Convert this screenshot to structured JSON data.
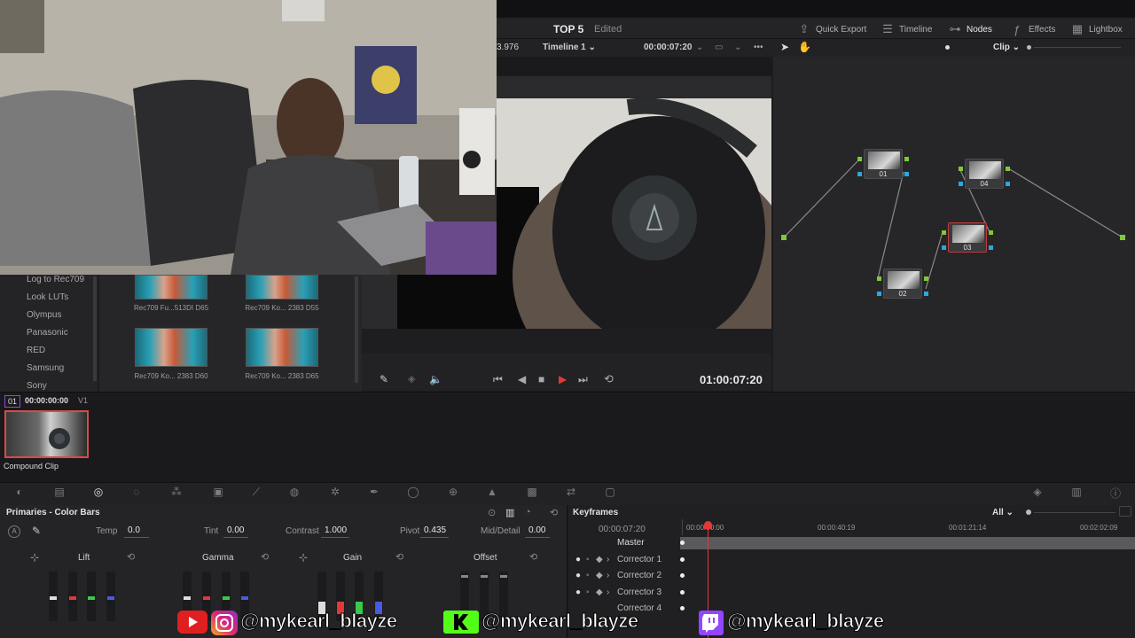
{
  "header": {
    "project_title": "TOP 5",
    "project_status": "Edited",
    "toolbar": [
      {
        "icon": "export-icon",
        "label": "Quick Export"
      },
      {
        "icon": "timeline-icon",
        "label": "Timeline"
      },
      {
        "icon": "nodes-icon",
        "label": "Nodes"
      },
      {
        "icon": "effects-icon",
        "label": "Effects"
      },
      {
        "icon": "lightbox-icon",
        "label": "Lightbox"
      }
    ]
  },
  "viewer": {
    "fps_fragment": "3.976",
    "timeline_name": "Timeline 1",
    "timecode_top": "00:00:07:20",
    "timecode_bottom": "01:00:07:20",
    "node_mode": "Clip"
  },
  "lut_browser": {
    "categories": [
      "Log to Rec709",
      "Look LUTs",
      "Olympus",
      "Panasonic",
      "RED",
      "Samsung",
      "Sony"
    ],
    "luts": [
      {
        "caption": "Rec709 Fu...513DI D65"
      },
      {
        "caption": "Rec709 Ko... 2383 D55"
      },
      {
        "caption": "Rec709 Ko... 2383 D60"
      },
      {
        "caption": "Rec709 Ko... 2383 D65"
      }
    ]
  },
  "nodes": [
    {
      "label": "01"
    },
    {
      "label": "02"
    },
    {
      "label": "03"
    },
    {
      "label": "04"
    }
  ],
  "clip": {
    "index": "01",
    "timecode": "00:00:00:00",
    "track": "V1",
    "name": "Compound Clip"
  },
  "primaries": {
    "title": "Primaries - Color Bars",
    "temp_label": "Temp",
    "temp": "0.0",
    "tint_label": "Tint",
    "tint": "0.00",
    "contrast_label": "Contrast",
    "contrast": "1.000",
    "pivot_label": "Pivot",
    "pivot": "0.435",
    "middetail_label": "Mid/Detail",
    "middetail": "0.00",
    "wheels": [
      "Lift",
      "Gamma",
      "Gain",
      "Offset"
    ]
  },
  "keyframes": {
    "title": "Keyframes",
    "filter": "All",
    "timecode": "00:00:07:20",
    "ruler": [
      "00:00:00:00",
      "00:00:40:19",
      "00:01:21:14",
      "00:02:02:09"
    ],
    "rows": [
      "Master",
      "Corrector 1",
      "Corrector 2",
      "Corrector 3",
      "Corrector 4"
    ]
  },
  "social": {
    "handle_1": "@mykearl_blayze",
    "handle_2": "@mykearl_blayze",
    "handle_3": "@mykearl_blayze"
  },
  "colors": {
    "accent_red": "#e0393a",
    "node_green": "#7ec93a",
    "node_blue": "#2aa8e0",
    "bg": "#1c1c1e"
  }
}
